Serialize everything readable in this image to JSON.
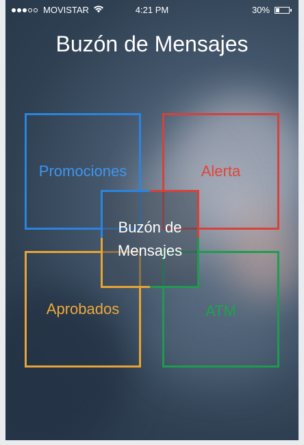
{
  "status_bar": {
    "carrier": "MOVISTAR",
    "signal_bars_filled": 3,
    "signal_bars_total": 5,
    "time": "4:21 PM",
    "battery_percent": "30%",
    "battery_level": 0.3
  },
  "header": {
    "title": "Buzón de Mensajes"
  },
  "tiles": {
    "promociones": {
      "label": "Promociones",
      "color": "#2a85e0"
    },
    "alerta": {
      "label": "Alerta",
      "color": "#d8403a"
    },
    "aprobados": {
      "label": "Aprobados",
      "color": "#e8a534"
    },
    "atm": {
      "label": "ATM",
      "color": "#1e9c4e"
    },
    "center": {
      "label": "Buzón de\nMensajes"
    }
  },
  "icons": [
    "wifi-icon",
    "battery-icon"
  ]
}
